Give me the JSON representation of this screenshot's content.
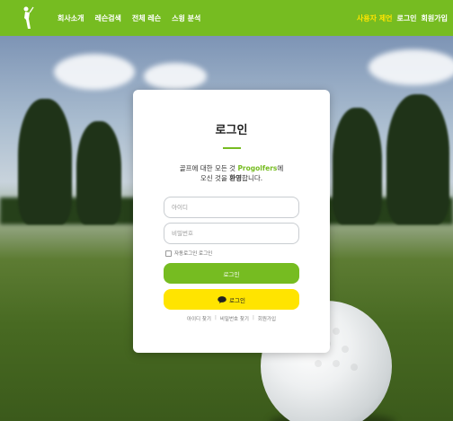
{
  "navbar": {
    "menu": [
      "회사소개",
      "레슨검색",
      "전체 레슨",
      "스윙 분석"
    ],
    "right_menu": [
      "사용자 제언",
      "로그인",
      "회원가입"
    ],
    "colors": {
      "bar": "#76bc21",
      "highlight": "#ffe400"
    }
  },
  "login": {
    "title": "로그인",
    "welcome_line1_prefix": "골프에 대한 모든 것 ",
    "brand": "Progolfers",
    "welcome_line1_suffix": "에",
    "welcome_line2_prefix": "오신 것을 ",
    "welcome_line2_emph": "환영",
    "welcome_line2_suffix": "합니다.",
    "id_placeholder": "아이디",
    "pw_placeholder": "비밀번호",
    "remember_label": "자동로그인 로그인",
    "login_button": "로그인",
    "kakao_button": "로그인",
    "links": [
      "아이디 찾기",
      "비밀번호 찾기",
      "회원가입"
    ],
    "colors": {
      "primary": "#76bc21",
      "kakao": "#ffe400"
    }
  }
}
